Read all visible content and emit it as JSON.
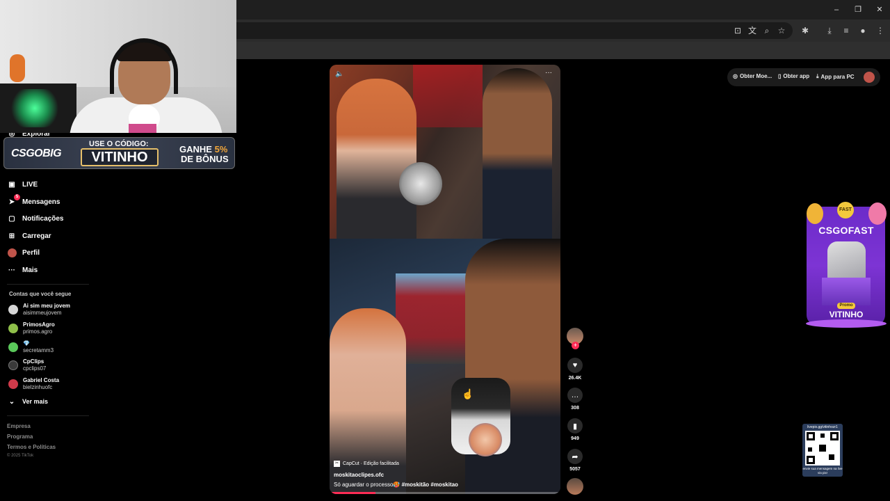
{
  "browser": {
    "window_controls": [
      "–",
      "❐",
      "✕"
    ],
    "toolbar_icons": [
      "install-icon",
      "translate-icon",
      "zoom-icon",
      "star-icon",
      "extensions-icon",
      "download-icon",
      "reading-list-icon",
      "profile-icon",
      "menu-icon"
    ]
  },
  "webcam_overlay": {
    "promo": {
      "logo": "CSGOBIG",
      "use_code_label": "USE O CÓDIGO:",
      "code": "VITINHO",
      "bonus_line1_prefix": "GANHE",
      "bonus_line1_percent": "5%",
      "bonus_line2": "DE BÔNUS"
    }
  },
  "sidebar": {
    "partial_top_item": "Explorar",
    "nav": [
      {
        "label": "LIVE",
        "icon": "live-icon"
      },
      {
        "label": "Mensagens",
        "icon": "messages-icon",
        "badge": "5"
      },
      {
        "label": "Notificações",
        "icon": "notifications-icon"
      },
      {
        "label": "Carregar",
        "icon": "upload-icon"
      },
      {
        "label": "Perfil",
        "icon": "profile-avatar"
      },
      {
        "label": "Mais",
        "icon": "more-icon"
      }
    ],
    "following_title": "Contas que você segue",
    "following": [
      {
        "name": "Ai sim meu jovem",
        "user": "aisimmeujovem",
        "color": "#d6d6d6"
      },
      {
        "name": "PrimosAgro",
        "user": "primos.agro",
        "color": "#8fbf4a"
      },
      {
        "name": "💎",
        "user": "secretamm3",
        "color": "#5ac85a"
      },
      {
        "name": "CpClips",
        "user": "cpclips07",
        "color": "#3a3a3a"
      },
      {
        "name": "Gabriel Costa",
        "user": "bielzinhuofc",
        "color": "#d03a4a"
      }
    ],
    "see_more": "Ver mais",
    "footer_links": [
      "Empresa",
      "Programa",
      "Termos e Políticas"
    ],
    "copyright": "© 2025 TikTok"
  },
  "header": {
    "buttons": [
      "Obter Moe...",
      "Obter app",
      "App para PC"
    ]
  },
  "video": {
    "capcut_label": "CapCut · Edição facilitada",
    "author": "moskitaoclipes.ofc",
    "description_text": "Só aguardar o processo🥵 ",
    "hashtags": "#moskitão  #moskitao",
    "progress": 0.2
  },
  "actions": {
    "likes": "26.4K",
    "comments": "308",
    "saves": "949",
    "shares": "5057"
  },
  "side_ad": {
    "brand": "CSGOFAST",
    "coin_text": "FAST",
    "promo_tag": "Promo",
    "code": "VITINHO"
  },
  "qr_panel": {
    "top_text": "livepix.gg/vitinhozr1",
    "bottom_text": "envie sua mensagem na live via pix!"
  }
}
